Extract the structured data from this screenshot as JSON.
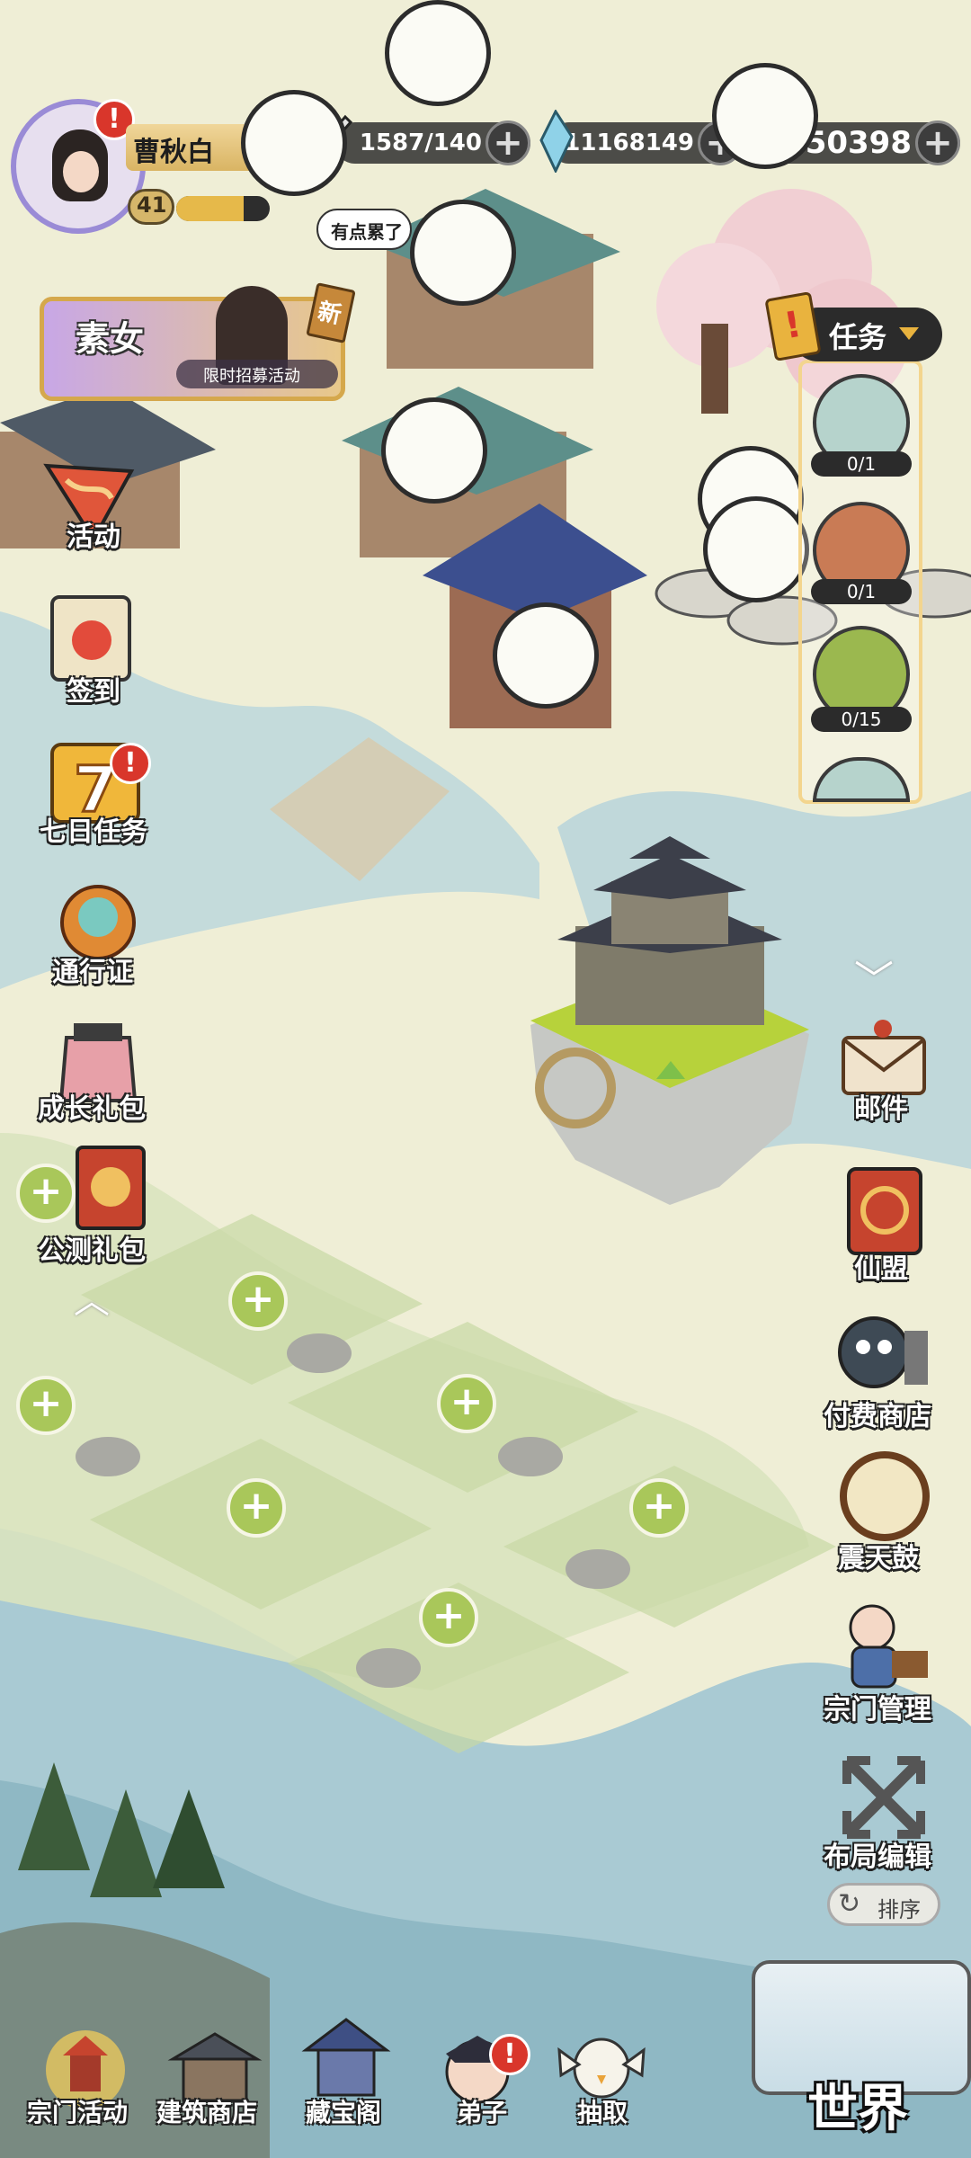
{
  "player": {
    "name": "曹秋白",
    "level": "41",
    "exp_fraction": 0.72
  },
  "resources": {
    "stamina": "1587/140",
    "spirit_stones": "11168149",
    "gems": "50398"
  },
  "character_bubble": "有点累了",
  "recruit_banner": {
    "name": "素女",
    "subtitle": "限时招募活动",
    "new_badge": "新"
  },
  "left_menu": [
    {
      "label": "活动",
      "icon": "activity-flag-icon"
    },
    {
      "label": "签到",
      "icon": "sign-in-scroll-icon"
    },
    {
      "label": "七日任务",
      "icon": "seven-day-icon"
    },
    {
      "label": "通行证",
      "icon": "pass-orb-icon"
    },
    {
      "label": "成长礼包",
      "icon": "growth-gift-icon"
    },
    {
      "label": "公测礼包",
      "icon": "public-test-gift-icon"
    }
  ],
  "task_panel": {
    "title": "任务",
    "slots": [
      {
        "count": "0/1",
        "icon": "building-icon",
        "color": "#b6d3cc"
      },
      {
        "count": "0/1",
        "icon": "sword-icon",
        "color": "#c97b55"
      },
      {
        "count": "0/15",
        "icon": "scroll-icon",
        "color": "#9bb84f"
      }
    ]
  },
  "right_menu": [
    {
      "label": "邮件",
      "icon": "mail-icon"
    },
    {
      "label": "仙盟",
      "icon": "alliance-banner-icon"
    },
    {
      "label": "付费商店",
      "icon": "shop-keeper-icon"
    },
    {
      "label": "震天鼓",
      "icon": "drum-icon"
    },
    {
      "label": "宗门管理",
      "icon": "sect-manager-icon"
    },
    {
      "label": "布局编辑",
      "icon": "layout-edit-icon"
    }
  ],
  "sort_button": "排序",
  "world_button": "世界",
  "bottom_nav": [
    {
      "label": "宗门活动",
      "icon": "sect-event-icon"
    },
    {
      "label": "建筑商店",
      "icon": "building-shop-icon"
    },
    {
      "label": "藏宝阁",
      "icon": "treasure-pavilion-icon"
    },
    {
      "label": "弟子",
      "icon": "disciple-icon"
    },
    {
      "label": "抽取",
      "icon": "draw-bird-icon"
    }
  ],
  "colors": {
    "alert": "#d9362b",
    "build_pin": "#a9c75a",
    "hud_bg": "#2b2b2b",
    "banner_gold": "#e8c36a"
  }
}
